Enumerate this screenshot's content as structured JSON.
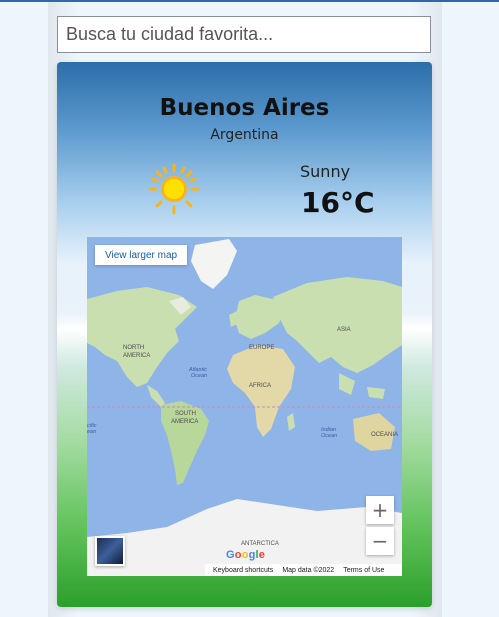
{
  "search": {
    "placeholder": "Busca tu ciudad favorita..."
  },
  "weather": {
    "city": "Buenos Aires",
    "country": "Argentina",
    "condition": "Sunny",
    "temperature": "16°C",
    "icon": "sun-icon"
  },
  "map": {
    "larger_map_label": "View larger map",
    "zoom_in": "+",
    "zoom_out": "−",
    "logo": "Google",
    "attribution": {
      "shortcuts": "Keyboard shortcuts",
      "data": "Map data ©2022",
      "terms": "Terms of Use"
    },
    "labels": {
      "north_america": "NORTH AMERICA",
      "south_america": "SOUTH AMERICA",
      "europe": "EUROPE",
      "africa": "AFRICA",
      "asia": "ASIA",
      "oceania": "OCEANIA",
      "antarctica": "ANTARCTICA",
      "atlantic": "Atlantic Ocean",
      "indian": "Indian Ocean",
      "pacific": "cific ean"
    }
  },
  "colors": {
    "map_water": "#8fb4e8",
    "land": "#c9dfb0",
    "sun": "#ffd100"
  }
}
